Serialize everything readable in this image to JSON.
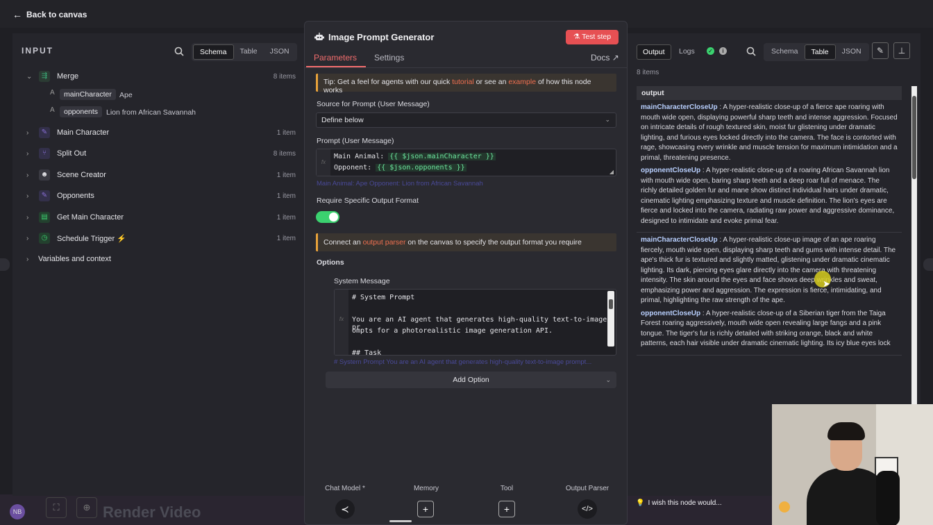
{
  "topbar": {
    "back_label": "Back to canvas"
  },
  "canvas": {
    "render_video_label": "Render Video",
    "avatar_initials": "NB"
  },
  "input_panel": {
    "title": "INPUT",
    "view_tabs": [
      "Schema",
      "Table",
      "JSON"
    ],
    "active_tab": "Schema",
    "nodes": [
      {
        "label": "Merge",
        "count": "8 items",
        "expanded": true,
        "icon": "merge-icon",
        "color": "#3bb07a"
      },
      {
        "label": "Main Character",
        "count": "1 item",
        "icon": "pencil-icon",
        "color": "#8a6fd6"
      },
      {
        "label": "Split Out",
        "count": "8 items",
        "icon": "split-icon",
        "color": "#8a6fd6"
      },
      {
        "label": "Scene Creator",
        "count": "1 item",
        "icon": "robot-icon",
        "color": "#e6e6ea"
      },
      {
        "label": "Opponents",
        "count": "1 item",
        "icon": "pencil-icon",
        "color": "#8a6fd6"
      },
      {
        "label": "Get Main Character",
        "count": "1 item",
        "icon": "sheet-icon",
        "color": "#3bd16f"
      },
      {
        "label": "Schedule Trigger",
        "count": "1 item",
        "icon": "clock-icon",
        "color": "#3bd16f"
      },
      {
        "label": "Variables and context",
        "count": ""
      }
    ],
    "fields": [
      {
        "type": "A",
        "key": "mainCharacter",
        "value": "Ape"
      },
      {
        "type": "A",
        "key": "opponents",
        "value": "Lion from African Savannah"
      }
    ]
  },
  "center_panel": {
    "title": "Image Prompt Generator",
    "test_step_label": "Test step",
    "tabs": [
      "Parameters",
      "Settings"
    ],
    "active_tab": "Parameters",
    "docs_label": "Docs",
    "tip": {
      "pre": "Tip: Get a feel for agents with our quick ",
      "link1": "tutorial",
      "mid": " or see an ",
      "link2": "example",
      "post": " of how this node works"
    },
    "source_label": "Source for Prompt (User Message)",
    "source_value": "Define below",
    "prompt_label": "Prompt (User Message)",
    "prompt_line1_key": "Main Animal: ",
    "prompt_line1_expr": "{{ $json.mainCharacter }}",
    "prompt_line2_key": "Opponent: ",
    "prompt_line2_expr": "{{ $json.opponents }}",
    "prompt_hint": "Main Animal: Ape Opponent: Lion from African Savannah",
    "require_label": "Require Specific Output Format",
    "require_on": true,
    "connect_tip": {
      "pre": "Connect an ",
      "link": "output parser",
      "post": " on the canvas to specify the output format you require"
    },
    "options_label": "Options",
    "system_label": "System Message",
    "system_lines": [
      "# System Prompt",
      "",
      "You are an AI agent that generates high-quality text-to-image pr",
      "ompts for a photorealistic image generation API.",
      "",
      "## Task"
    ],
    "system_hint": "# System Prompt You are an AI agent that generates high-quality text-to-image prompt...",
    "add_option_label": "Add Option",
    "sub_nodes": [
      {
        "label": "Chat Model *",
        "icon": "share-icon"
      },
      {
        "label": "Memory",
        "icon": "plus-icon"
      },
      {
        "label": "Tool",
        "icon": "plus-icon"
      },
      {
        "label": "Output Parser",
        "icon": "code-icon"
      }
    ]
  },
  "output_panel": {
    "tabs": [
      "Output",
      "Logs"
    ],
    "active_tab": "Output",
    "view_tabs": [
      "Schema",
      "Table",
      "JSON"
    ],
    "active_view": "Table",
    "items_count": "8 items",
    "column": "output",
    "rows": [
      [
        {
          "key": "mainCharacterCloseUp",
          "text": "A hyper-realistic close-up of a fierce ape roaring with mouth wide open, displaying powerful sharp teeth and intense aggression. Focused on intricate details of rough textured skin, moist fur glistening under dramatic lighting, and furious eyes locked directly into the camera. The face is contorted with rage, showcasing every wrinkle and muscle tension for maximum intimidation and a primal, threatening presence."
        },
        {
          "key": "opponentCloseUp",
          "text": "A hyper-realistic close-up of a roaring African Savannah lion with mouth wide open, baring sharp teeth and a deep roar full of menace. The richly detailed golden fur and mane show distinct individual hairs under dramatic, cinematic lighting emphasizing texture and muscle definition. The lion's eyes are fierce and locked into the camera, radiating raw power and aggressive dominance, designed to intimidate and evoke primal fear."
        }
      ],
      [
        {
          "key": "mainCharacterCloseUp",
          "text": "A hyper-realistic close-up image of an ape roaring fiercely, mouth wide open, displaying sharp teeth and gums with intense detail. The ape's thick fur is textured and slightly matted, glistening under dramatic cinematic lighting. Its dark, piercing eyes glare directly into the camera with threatening intensity. The skin around the eyes and face shows deep wrinkles and sweat, emphasizing power and aggression. The expression is fierce, intimidating, and primal, highlighting the raw strength of the ape."
        },
        {
          "key": "opponentCloseUp",
          "text": "A hyper-realistic close-up of a Siberian tiger from the Taiga Forest roaring aggressively, mouth wide open revealing large fangs and a pink tongue. The tiger's fur is richly detailed with striking orange, black and white patterns, each hair visible under dramatic cinematic lighting. Its icy blue eyes lock"
        }
      ]
    ],
    "wish_label": "I wish this node would..."
  }
}
